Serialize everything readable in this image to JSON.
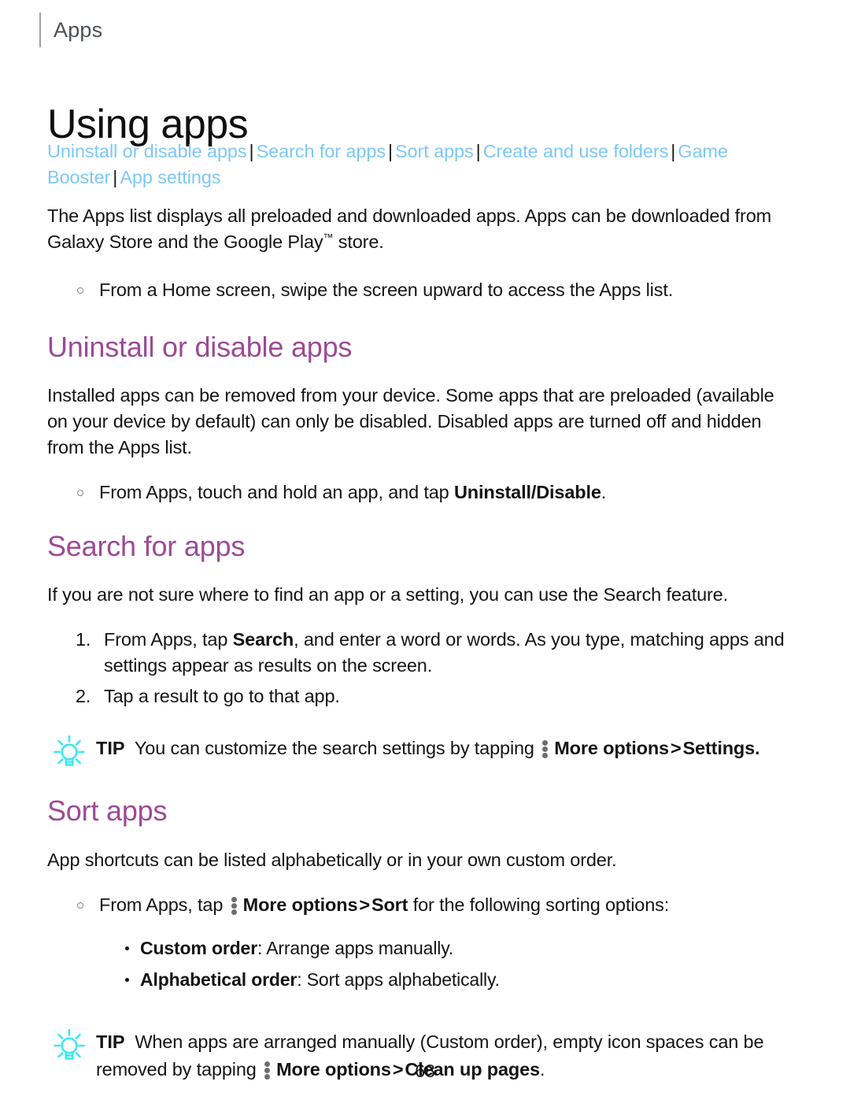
{
  "header": {
    "running_label": "Apps"
  },
  "title": "Using apps",
  "nav": {
    "separator": "|",
    "links": [
      "Uninstall or disable apps",
      "Search for apps",
      "Sort apps",
      "Create and use folders",
      "Game Booster",
      "App settings"
    ]
  },
  "intro": {
    "paragraph_part1": "The Apps list displays all preloaded and downloaded apps. Apps can be downloaded from Galaxy Store and the Google Play",
    "trademark": "™",
    "paragraph_part2": " store.",
    "bullet": "From a Home screen, swipe the screen upward to access the Apps list."
  },
  "sections": [
    {
      "heading": "Uninstall or disable apps",
      "paragraph": "Installed apps can be removed from your device. Some apps that are preloaded (available on your device by default) can only be disabled. Disabled apps are turned off and hidden from the Apps list.",
      "bullet_prefix": "From Apps, touch and hold an app, and tap ",
      "bullet_bold": "Uninstall/Disable",
      "bullet_suffix": "."
    },
    {
      "heading": "Search for apps",
      "paragraph": "If you are not sure where to find an app or a setting, you can use the Search feature.",
      "steps": [
        {
          "prefix": "From Apps, tap ",
          "bold": "Search",
          "suffix": ", and enter a word or words. As you type, matching apps and settings appear as results on the screen."
        },
        {
          "prefix": "Tap a result to go to that app.",
          "bold": "",
          "suffix": ""
        }
      ],
      "tip": {
        "label": "TIP",
        "text_before_icon": "You can customize the search settings by tapping ",
        "icon": "more-options-kebab-icon",
        "bold_after_icon": "More options",
        "chevron": ">",
        "bold_target": "Settings",
        "trailing": "."
      }
    },
    {
      "heading": "Sort apps",
      "paragraph": "App shortcuts can be listed alphabetically or in your own custom order.",
      "bullet": {
        "prefix": "From Apps, tap ",
        "bold_after_icon": "More options",
        "chevron": ">",
        "bold_target": "Sort",
        "suffix": " for the following sorting options:"
      },
      "options": [
        {
          "label": "Custom order",
          "desc": ": Arrange apps manually."
        },
        {
          "label": "Alphabetical order",
          "desc": ": Sort apps alphabetically."
        }
      ],
      "tip": {
        "label": "TIP",
        "text_line1": "When apps are arranged manually (Custom order), empty icon spaces",
        "text_line2": "can be removed by tapping ",
        "icon": "more-options-kebab-icon",
        "bold_after_icon": "More options",
        "chevron": ">",
        "bold_target": "Clean up pages",
        "trailing": "."
      }
    }
  ],
  "footer": {
    "page_number": "68"
  },
  "colors": {
    "link": "#7EC8F7",
    "heading": "#9C4A96",
    "tip_icon": "#3DE8F0",
    "body_text": "#141414",
    "kebab_dots": "#6E6E6E",
    "header_rule": "#9AA0A6"
  }
}
